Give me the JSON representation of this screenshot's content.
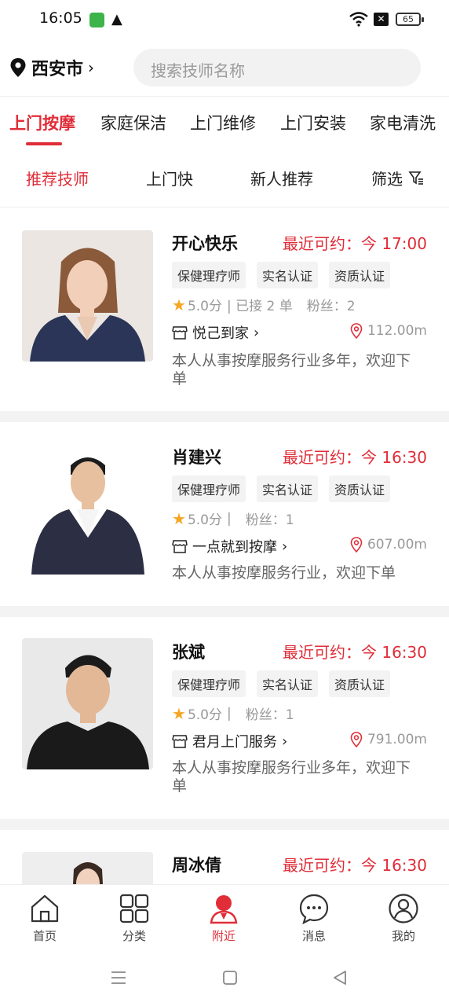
{
  "status_bar": {
    "time": "16:05",
    "battery": "65"
  },
  "header": {
    "city": "西安市",
    "search_placeholder": "搜索技师名称"
  },
  "categories": [
    "上门按摩",
    "家庭保洁",
    "上门维修",
    "上门安装",
    "家电清洗"
  ],
  "filters": {
    "items": [
      "推荐技师",
      "上门快",
      "新人推荐"
    ],
    "filter_label": "筛选"
  },
  "technicians": [
    {
      "name": "开心快乐",
      "availability": "最近可约：今 17:00",
      "tags": [
        "保健理疗师",
        "实名认证",
        "资质认证"
      ],
      "rating": "5.0分",
      "orders": "| 已接 2 单",
      "fans": "粉丝：2",
      "shop": "悦己到家",
      "distance": "112.00m",
      "description": "本人从事按摩服务行业多年，欢迎下单"
    },
    {
      "name": "肖建兴",
      "availability": "最近可约：今 16:30",
      "tags": [
        "保健理疗师",
        "实名认证",
        "资质认证"
      ],
      "rating": "5.0分",
      "orders": "|",
      "fans": "粉丝：1",
      "shop": "一点就到按摩",
      "distance": "607.00m",
      "description": "本人从事按摩服务行业，欢迎下单"
    },
    {
      "name": "张斌",
      "availability": "最近可约：今 16:30",
      "tags": [
        "保健理疗师",
        "实名认证",
        "资质认证"
      ],
      "rating": "5.0分",
      "orders": "|",
      "fans": "粉丝：1",
      "shop": "君月上门服务",
      "distance": "791.00m",
      "description": "本人从事按摩服务行业多年，欢迎下单"
    },
    {
      "name": "周冰倩",
      "availability": "最近可约：今 16:30"
    }
  ],
  "bottom_nav": [
    "首页",
    "分类",
    "附近",
    "消息",
    "我的"
  ],
  "colors": {
    "accent": "#e02d38",
    "star": "#f5a623"
  }
}
